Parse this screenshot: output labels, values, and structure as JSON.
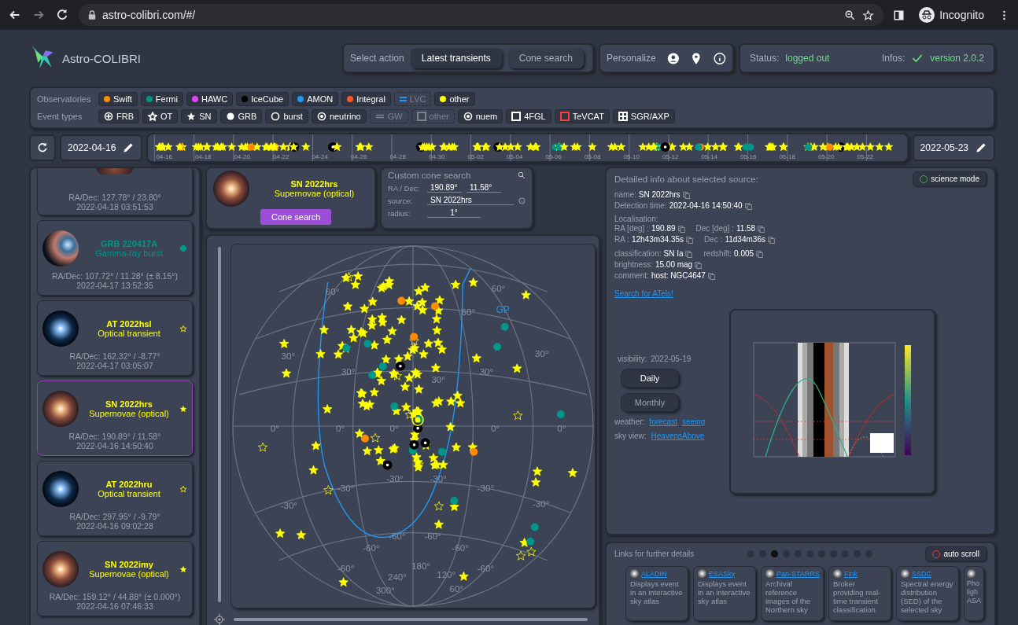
{
  "browser": {
    "url": "astro-colibri.com/#/",
    "profile": "Incognito"
  },
  "app": {
    "title": "Astro-COLIBRI"
  },
  "actions": {
    "label": "Select action",
    "buttons": [
      {
        "label": "Latest transients",
        "selected": true
      },
      {
        "label": "Cone search",
        "selected": false
      }
    ]
  },
  "personalize": {
    "label": "Personalize"
  },
  "status": {
    "label": "Status:",
    "value": "logged out",
    "infos_label": "Infos:",
    "version": "version 2.0.2"
  },
  "observatories": {
    "label": "Observatories",
    "items": [
      {
        "label": "Swift",
        "kind": "dot",
        "color": "#ff8c00",
        "disabled": false
      },
      {
        "label": "Fermi",
        "kind": "dot",
        "color": "#009688",
        "disabled": false
      },
      {
        "label": "HAWC",
        "kind": "dot",
        "color": "#e040fb",
        "disabled": false
      },
      {
        "label": "IceCube",
        "kind": "dot",
        "color": "#000000",
        "disabled": false
      },
      {
        "label": "AMON",
        "kind": "dot",
        "color": "#2196f3",
        "disabled": false
      },
      {
        "label": "Integral",
        "kind": "dot",
        "color": "#ff5722",
        "disabled": false
      },
      {
        "label": "LVC",
        "kind": "line",
        "color": "#2196f3",
        "disabled": true
      },
      {
        "label": "other",
        "kind": "dot",
        "color": "#ffff00",
        "disabled": false
      }
    ]
  },
  "event_types": {
    "label": "Event types",
    "items": [
      {
        "kind": "crosshair",
        "label": "FRB",
        "color": "#ffffff",
        "disabled": false
      },
      {
        "kind": "star-outline",
        "label": "OT",
        "color": "#ffffff",
        "disabled": false
      },
      {
        "kind": "star",
        "label": "SN",
        "color": "#ffffff",
        "disabled": false
      },
      {
        "kind": "dot",
        "label": "GRB",
        "color": "#ffffff",
        "disabled": false
      },
      {
        "kind": "ring",
        "label": "burst",
        "color": "#ffffff",
        "disabled": false
      },
      {
        "kind": "target",
        "label": "neutrino",
        "color": "#ffffff",
        "disabled": false
      },
      {
        "kind": "double-line",
        "label": "GW",
        "color": "#7c8290",
        "disabled": true
      },
      {
        "kind": "square",
        "label": "other",
        "color": "#7c8290",
        "disabled": true
      },
      {
        "kind": "target",
        "label": "nuem",
        "color": "#ffffff",
        "disabled": false
      },
      {
        "kind": "square",
        "label": "4FGL",
        "color": "#ffffff",
        "disabled": false
      },
      {
        "kind": "square",
        "label": "TeVCAT",
        "color": "#ff3b3b",
        "disabled": false
      },
      {
        "kind": "square-grid",
        "label": "SGR/AXP",
        "color": "#ffffff",
        "disabled": false
      }
    ]
  },
  "timeline": {
    "start_date": "2022-04-16",
    "end_date": "2022-05-23",
    "ticks": [
      "04-16",
      "04-18",
      "04-20",
      "04-22",
      "04-24",
      "04-26",
      "04-28",
      "04-30",
      "05-02",
      "05-04",
      "05-06",
      "05-08",
      "05-10",
      "05-12",
      "05-14",
      "05-16",
      "05-18",
      "05-20",
      "05-22"
    ]
  },
  "sources": [
    {
      "kind": "sn",
      "ra_dec": "RA/Dec: 127.78° / 23.80°",
      "time": "2022-04-18 03:51:53",
      "selected": false
    },
    {
      "kind": "grb",
      "name": "GRB 220417A",
      "type": "Gamma-ray burst",
      "color": "#009688",
      "ra_dec": "RA/Dec: 107.72° / 11.28° (± 8.15°)",
      "time": "2022-04-17 13:52:35",
      "selected": false
    },
    {
      "kind": "ot",
      "name": "AT 2022hsl",
      "type": "Optical transient",
      "color": "#ffff00",
      "ra_dec": "RA/Dec: 162.32° / -8.77°",
      "time": "2022-04-17 03:05:07",
      "selected": false
    },
    {
      "kind": "sn",
      "name": "SN 2022hrs",
      "type": "Supernovae (optical)",
      "color": "#ffff00",
      "ra_dec": "RA/Dec: 190.89° / 11.58°",
      "time": "2022-04-16 14:50:40",
      "selected": true
    },
    {
      "kind": "ot",
      "name": "AT 2022hru",
      "type": "Optical transient",
      "color": "#ffff00",
      "ra_dec": "RA/Dec: 297.95° / -9.79°",
      "time": "2022-04-16 09:02:28",
      "selected": false
    },
    {
      "kind": "sn",
      "name": "SN 2022imy",
      "type": "Supernovae (optical)",
      "color": "#ffff00",
      "ra_dec": "RA/Dec: 159.12° / 44.88° (± 0.000°)",
      "time": "2022-04-16 07:46:33",
      "selected": false
    }
  ],
  "selected_source": {
    "name": "SN 2022hrs",
    "type": "Supernovae (optical)",
    "button": "Cone search"
  },
  "cone_search": {
    "title": "Custom cone search",
    "ra_dec_label": "RA / Dec:",
    "ra": "190.89°",
    "dec": "11.58°",
    "source_label": "source:",
    "source": "SN 2022hrs",
    "radius_label": "radius:",
    "radius": "1°"
  },
  "sky_map": {
    "gp_label": "GP",
    "vertical_slider": {
      "level": 1
    },
    "horizontal_slider": {
      "level": 1
    },
    "grid_labels": [
      "60°",
      "60°",
      "60°",
      "30°",
      "30°",
      "30°",
      "30°",
      "30°",
      "0°",
      "0°",
      "0°",
      "0°",
      "0°",
      "-30°",
      "-30°",
      "-30°",
      "-30°",
      "-30°",
      "-30°",
      "-60°",
      "-60°",
      "-60°",
      "-60°",
      "-60°",
      "-60°",
      "240°",
      "180°",
      "120°",
      "60°",
      "300°"
    ]
  },
  "detail": {
    "title": "Detailed info about selected source:",
    "science_mode": {
      "label": "science mode",
      "on": false
    },
    "sections": [
      {
        "rows": [
          [
            {
              "label": "name:",
              "value": "SN 2022hrs"
            }
          ],
          [
            {
              "label": "Detection time:",
              "value": "2022-04-16 14:50:40"
            }
          ]
        ]
      },
      {
        "heading": "Localisation:",
        "rows": [
          [
            {
              "label": "RA [deg] :",
              "value": "190.89"
            },
            {
              "label": "Dec [deg] :",
              "value": "11.58"
            }
          ],
          [
            {
              "label": "RA :",
              "value": "12h43m34.35s"
            },
            {
              "label": "Dec :",
              "value": "11d34m36s"
            }
          ]
        ]
      },
      {
        "rows": [
          [
            {
              "label": "classification:",
              "value": "SN Ia"
            },
            {
              "label": "redshift:",
              "value": "0.005"
            }
          ],
          [
            {
              "label": "brightness:",
              "value": "15.00 mag"
            }
          ],
          [
            {
              "label": "comment:",
              "value": "host: NGC4647"
            }
          ]
        ]
      }
    ],
    "atel_link": "Search for ATels!",
    "visibility": {
      "label": "visibility:",
      "date": "2022-05-19",
      "buttons": [
        {
          "label": "Daily",
          "selected": true
        },
        {
          "label": "Monthly",
          "selected": false
        }
      ],
      "weather_label": "weather:",
      "weather_links": [
        "forecast",
        "seeing"
      ],
      "sky_view_label": "sky view:",
      "sky_view_link": "HeavensAbove"
    }
  },
  "links": {
    "title": "Links for further details",
    "auto_scroll": {
      "label": "auto scroll",
      "on": false
    },
    "pages": [
      {
        "selected": false
      },
      {
        "selected": false
      },
      {
        "selected": true
      },
      {
        "selected": false
      },
      {
        "selected": false
      },
      {
        "selected": false
      },
      {
        "selected": false
      },
      {
        "selected": false
      },
      {
        "selected": false
      },
      {
        "selected": false
      },
      {
        "selected": false
      }
    ],
    "cards": [
      {
        "name": "ALADIN",
        "description": "Displays event in an interactive sky atlas"
      },
      {
        "name": "ESASky",
        "description": "Displays event in an interactive sky atlas"
      },
      {
        "name": "Pan-STARRS",
        "description": "Archival reference images of the Northern sky"
      },
      {
        "name": "Fink",
        "description": "Broker providing real-time transient classification"
      },
      {
        "name": "SSDC",
        "description": "Spectral energy distribution (SED) of the selected sky"
      },
      {
        "description": "Pho ligh ASA"
      }
    ]
  }
}
